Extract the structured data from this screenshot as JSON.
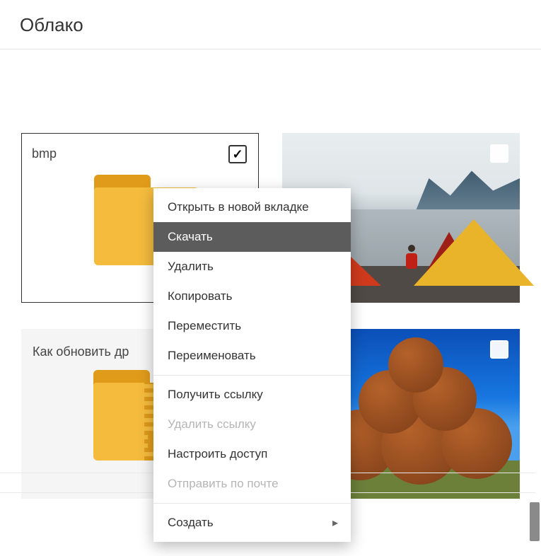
{
  "header": {
    "title": "Облако"
  },
  "items": {
    "folder": {
      "label": "bmp",
      "checked": true
    },
    "zip": {
      "label": "Как обновить др"
    },
    "photo1": {
      "checked": false
    },
    "photo2": {
      "checked": false
    }
  },
  "context_menu": {
    "groups": [
      [
        {
          "label": "Открыть в новой вкладке",
          "selected": false,
          "disabled": false
        },
        {
          "label": "Скачать",
          "selected": true,
          "disabled": false
        },
        {
          "label": "Удалить",
          "selected": false,
          "disabled": false
        },
        {
          "label": "Копировать",
          "selected": false,
          "disabled": false
        },
        {
          "label": "Переместить",
          "selected": false,
          "disabled": false
        },
        {
          "label": "Переименовать",
          "selected": false,
          "disabled": false
        }
      ],
      [
        {
          "label": "Получить ссылку",
          "selected": false,
          "disabled": false
        },
        {
          "label": "Удалить ссылку",
          "selected": false,
          "disabled": true
        },
        {
          "label": "Настроить доступ",
          "selected": false,
          "disabled": false
        },
        {
          "label": "Отправить по почте",
          "selected": false,
          "disabled": true
        }
      ],
      [
        {
          "label": "Создать",
          "selected": false,
          "disabled": false,
          "submenu": true
        }
      ]
    ]
  }
}
